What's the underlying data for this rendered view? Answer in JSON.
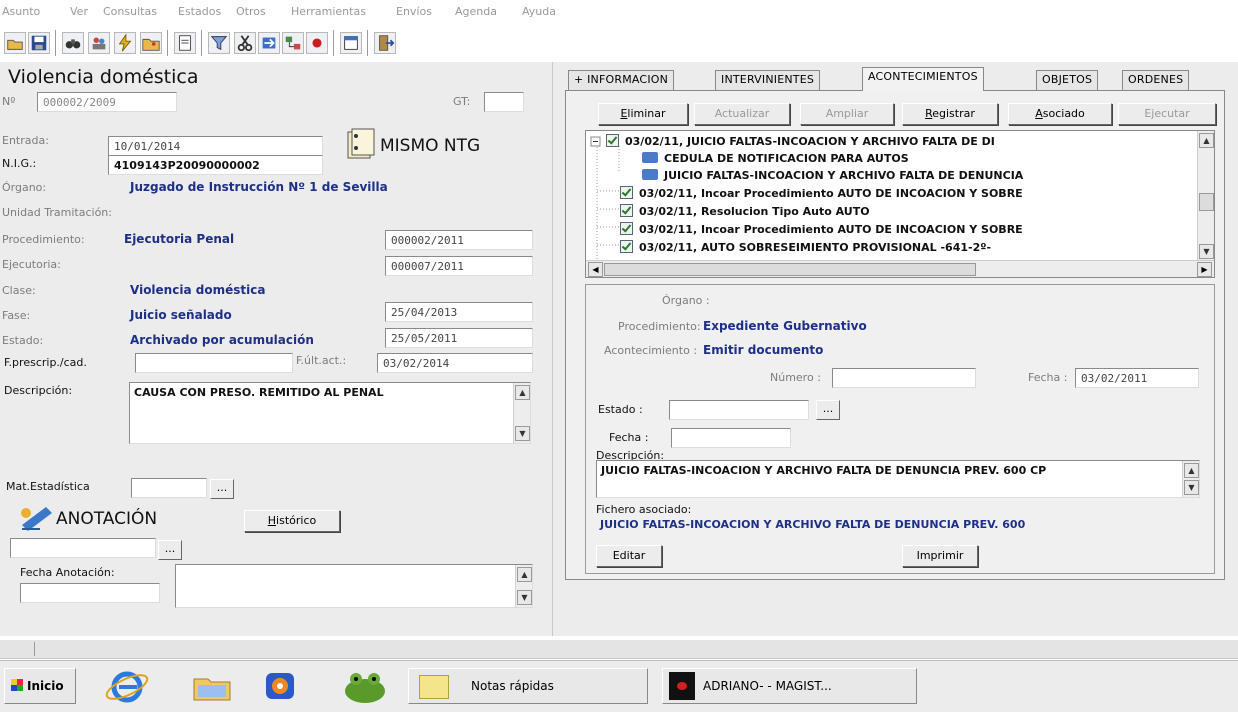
{
  "menu": [
    "Asunto",
    "Ver",
    "Consultas",
    "Estados",
    "Otros",
    "Herramientas",
    "Envíos",
    "Agenda",
    "Ayuda"
  ],
  "left": {
    "title": "Violencia doméstica",
    "no_label": "Nº",
    "no_value": "000002/2009",
    "gt_label": "GT:",
    "gt_value": "",
    "entrada_label": "Entrada:",
    "entrada_value": "10/01/2014",
    "nig_label": "N.I.G.:",
    "nig_value": "4109143P20090000002",
    "mismo_ntg": "MISMO NTG",
    "organo_label": "Órgano:",
    "organo_value": "Juzgado de Instrucción Nº 1 de Sevilla",
    "unidad_label": "Unidad Tramitación:",
    "procedimiento_label": "Procedimiento:",
    "procedimiento_value": "Ejecutoria Penal",
    "procedimiento_num": "000002/2011",
    "ejecutoria_label": "Ejecutoria:",
    "ejecutoria_num": "000007/2011",
    "clase_label": "Clase:",
    "clase_value": "Violencia doméstica",
    "fase_label": "Fase:",
    "fase_value": "Juicio señalado",
    "fase_date": "25/04/2013",
    "estado_label": "Estado:",
    "estado_value": "Archivado por acumulación",
    "estado_date": "25/05/2011",
    "fprescrip_label": "F.prescrip./cad.",
    "fprescrip_value": "",
    "fultact_label": "F.últ.act.:",
    "fultact_value": "03/02/2014",
    "descripcion_label": "Descripción:",
    "descripcion_value": "CAUSA CON PRESO. REMITIDO AL PENAL",
    "matest_label": "Mat.Estadística",
    "matest_value": "",
    "dots": "...",
    "anotacion_title": "ANOTACIÓN",
    "historico_button": "Histórico",
    "anot_value": "",
    "fecha_anot_label": "Fecha Anotación:",
    "fecha_anot_value": ""
  },
  "tabs": [
    "+ INFORMACION",
    "INTERVINIENTES",
    "ACONTECIMIENTOS",
    "OBJETOS",
    "ORDENES"
  ],
  "actions": [
    "Eliminar",
    "Actualizar",
    "Ampliar",
    "Registrar",
    "Asociado",
    "Ejecutar"
  ],
  "tree_items": [
    "03/02/11, JUICIO FALTAS-INCOACION Y ARCHIVO FALTA DE DI",
    "CEDULA DE NOTIFICACION PARA AUTOS",
    "JUICIO FALTAS-INCOACION Y ARCHIVO FALTA DE DENUNCIA",
    "03/02/11, Incoar Procedimiento AUTO DE INCOACION Y SOBRE",
    "03/02/11, Resolucion Tipo Auto AUTO",
    "03/02/11, Incoar Procedimiento AUTO DE INCOACION Y SOBRE",
    "03/02/11, AUTO SOBRESEIMIENTO PROVISIONAL -641-2º-"
  ],
  "detail": {
    "organo_label": "Órgano :",
    "organo_value": "",
    "procedimiento_label": "Procedimiento:",
    "procedimiento_value": "Expediente Gubernativo",
    "acontecimiento_label": "Acontecimiento :",
    "acontecimiento_value": "Emitir documento",
    "numero_label": "Número :",
    "numero_value": "",
    "fecha_label": "Fecha :",
    "fecha_value": "03/02/2011",
    "estado_label": "Estado :",
    "estado_value": "",
    "dots": "...",
    "fecha2_label": "Fecha :",
    "fecha2_value": "",
    "descripcion_label": "Descripción:",
    "descripcion_value": "JUICIO FALTAS-INCOACION Y ARCHIVO FALTA DE DENUNCIA PREV. 600 CP",
    "fichero_label": "Fichero asociado:",
    "fichero_value": "JUICIO FALTAS-INCOACION Y ARCHIVO FALTA DE DENUNCIA PREV. 600",
    "editar_button": "Editar",
    "imprimir_button": "Imprimir"
  },
  "taskbar": {
    "start": "Inicio",
    "notas": "Notas rápidas",
    "app": "ADRIANO- - MAGIST..."
  },
  "icons": [
    "save-icon",
    "folder-icon",
    "printer-icon",
    "user-icon",
    "cut-icon",
    "exit-icon",
    "ie-icon",
    "explorer-icon",
    "media-icon",
    "frog-icon",
    "notes-icon",
    "adriano-icon"
  ]
}
